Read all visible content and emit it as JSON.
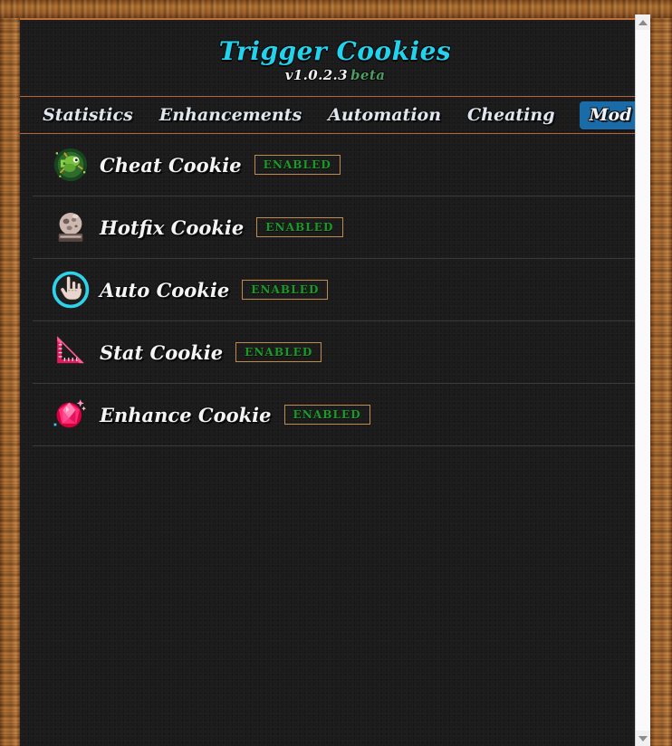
{
  "window": {
    "frame_color": "#9c5e27",
    "panel_bg": "#1b1b1b",
    "accent_rule": "#b4663a"
  },
  "header": {
    "title": "Trigger Cookies",
    "version": "v1.0.2.3",
    "version_tag": "beta",
    "title_color": "#22d3ee",
    "version_color": "#f2f2f2",
    "tag_color": "#4e9c62"
  },
  "tabs": [
    {
      "label": "Statistics",
      "active": false
    },
    {
      "label": "Enhancements",
      "active": false
    },
    {
      "label": "Automation",
      "active": false
    },
    {
      "label": "Cheating",
      "active": false
    },
    {
      "label": "Mod List",
      "active": true
    }
  ],
  "active_tab_color": "#1a6ca8",
  "mods": [
    {
      "name": "Cheat Cookie",
      "status": "ENABLED",
      "icon": "green-bug-icon"
    },
    {
      "name": "Hotfix Cookie",
      "status": "ENABLED",
      "icon": "stone-statue-icon"
    },
    {
      "name": "Auto Cookie",
      "status": "ENABLED",
      "icon": "pointing-hand-cursor-icon"
    },
    {
      "name": "Stat Cookie",
      "status": "ENABLED",
      "icon": "pink-triangle-ruler-icon"
    },
    {
      "name": "Enhance Cookie",
      "status": "ENABLED",
      "icon": "pink-gem-icon"
    }
  ],
  "status_colors": {
    "enabled_text": "#1a9a26",
    "enabled_border": "#c08a4e"
  },
  "scrollbar": {
    "up_arrow": "scroll-up-arrow",
    "down_arrow": "scroll-down-arrow",
    "track_color": "#f0f0f0"
  }
}
